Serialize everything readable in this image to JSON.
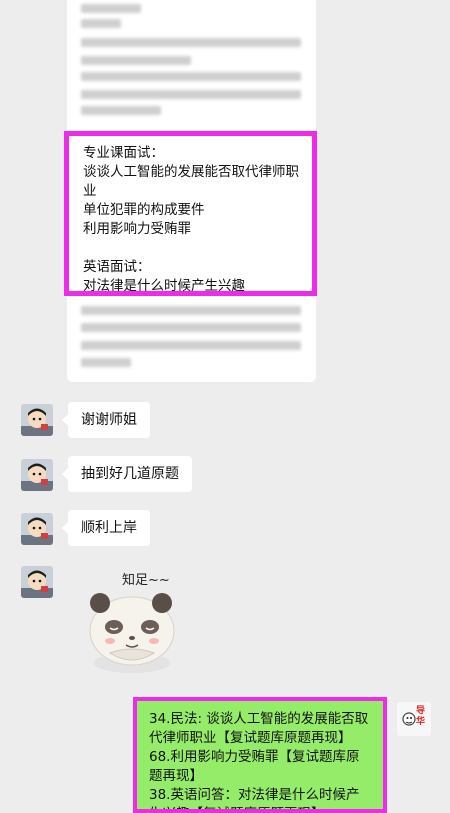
{
  "highlighted_message": {
    "lines": [
      "专业课面试：",
      "谈谈人工智能的发展能否取代律师职",
      "业",
      "单位犯罪的构成要件",
      "利用影响力受贿罪",
      "",
      "英语面试：",
      "对法律是什么时候产生兴趣"
    ]
  },
  "messages": [
    {
      "text": "谢谢师姐"
    },
    {
      "text": "抽到好几道原题"
    },
    {
      "text": "顺利上岸"
    }
  ],
  "sticker": {
    "caption": "知足~~",
    "icon": "panda-sticker"
  },
  "reply": {
    "lines": [
      "34.民法: 谈谈人工智能的发展能否取",
      "代律师职业【复试题库原题再现】",
      "68.利用影响力受贿罪【复试题库原",
      "题再现】",
      "38.英语问答：对法律是什么时候产",
      "生兴趣【复试题库原题再现】"
    ]
  },
  "self_avatar": {
    "text": "导华"
  },
  "colors": {
    "highlight": "#ee2be8",
    "outgoing": "#95ec69",
    "background": "#ededed"
  }
}
